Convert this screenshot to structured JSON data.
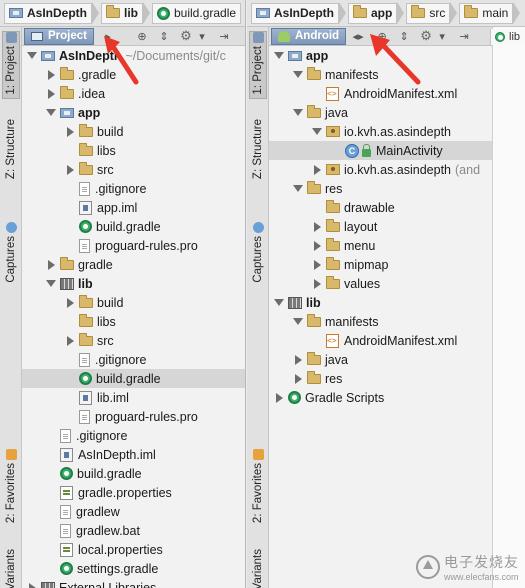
{
  "left": {
    "breadcrumbs": [
      "AsInDepth",
      "lib",
      "build.gradle"
    ],
    "view_label": "Project",
    "side_tabs": [
      "1: Project",
      "Z: Structure",
      "Captures",
      "2: Favorites",
      "Variants"
    ],
    "tree": [
      {
        "depth": 0,
        "arrow": "down",
        "icon": "module",
        "label": "AsInDepth",
        "bold": true,
        "hint": "~/Documents/git/c"
      },
      {
        "depth": 1,
        "arrow": "right",
        "icon": "folder",
        "label": ".gradle"
      },
      {
        "depth": 1,
        "arrow": "right",
        "icon": "folder",
        "label": ".idea"
      },
      {
        "depth": 1,
        "arrow": "down",
        "icon": "module",
        "label": "app",
        "bold": true
      },
      {
        "depth": 2,
        "arrow": "right",
        "icon": "folder",
        "label": "build"
      },
      {
        "depth": 2,
        "arrow": "none",
        "icon": "folder",
        "label": "libs"
      },
      {
        "depth": 2,
        "arrow": "right",
        "icon": "folder",
        "label": "src"
      },
      {
        "depth": 2,
        "arrow": "none",
        "icon": "file",
        "label": ".gitignore"
      },
      {
        "depth": 2,
        "arrow": "none",
        "icon": "iml",
        "label": "app.iml"
      },
      {
        "depth": 2,
        "arrow": "none",
        "icon": "gradle",
        "label": "build.gradle"
      },
      {
        "depth": 2,
        "arrow": "none",
        "icon": "file",
        "label": "proguard-rules.pro"
      },
      {
        "depth": 1,
        "arrow": "right",
        "icon": "folder",
        "label": "gradle"
      },
      {
        "depth": 1,
        "arrow": "down",
        "icon": "lib",
        "label": "lib",
        "bold": true
      },
      {
        "depth": 2,
        "arrow": "right",
        "icon": "folder",
        "label": "build"
      },
      {
        "depth": 2,
        "arrow": "none",
        "icon": "folder",
        "label": "libs"
      },
      {
        "depth": 2,
        "arrow": "right",
        "icon": "folder",
        "label": "src"
      },
      {
        "depth": 2,
        "arrow": "none",
        "icon": "file",
        "label": ".gitignore"
      },
      {
        "depth": 2,
        "arrow": "none",
        "icon": "gradle",
        "label": "build.gradle",
        "selected": true
      },
      {
        "depth": 2,
        "arrow": "none",
        "icon": "iml",
        "label": "lib.iml"
      },
      {
        "depth": 2,
        "arrow": "none",
        "icon": "file",
        "label": "proguard-rules.pro"
      },
      {
        "depth": 1,
        "arrow": "none",
        "icon": "file",
        "label": ".gitignore"
      },
      {
        "depth": 1,
        "arrow": "none",
        "icon": "iml",
        "label": "AsInDepth.iml"
      },
      {
        "depth": 1,
        "arrow": "none",
        "icon": "gradle",
        "label": "build.gradle"
      },
      {
        "depth": 1,
        "arrow": "none",
        "icon": "props",
        "label": "gradle.properties"
      },
      {
        "depth": 1,
        "arrow": "none",
        "icon": "file",
        "label": "gradlew"
      },
      {
        "depth": 1,
        "arrow": "none",
        "icon": "file",
        "label": "gradlew.bat"
      },
      {
        "depth": 1,
        "arrow": "none",
        "icon": "props",
        "label": "local.properties"
      },
      {
        "depth": 1,
        "arrow": "none",
        "icon": "gradle",
        "label": "settings.gradle"
      },
      {
        "depth": 0,
        "arrow": "right",
        "icon": "lib",
        "label": "External Libraries"
      }
    ]
  },
  "right": {
    "breadcrumbs": [
      "AsInDepth",
      "app",
      "src",
      "main"
    ],
    "view_label": "Android",
    "side_tabs": [
      "1: Project",
      "Z: Structure",
      "Captures",
      "2: Favorites",
      "Variants"
    ],
    "tab_peek": "lib",
    "tree": [
      {
        "depth": 0,
        "arrow": "down",
        "icon": "module",
        "label": "app",
        "bold": true
      },
      {
        "depth": 1,
        "arrow": "down",
        "icon": "folder",
        "label": "manifests"
      },
      {
        "depth": 2,
        "arrow": "none",
        "icon": "xml",
        "label": "AndroidManifest.xml"
      },
      {
        "depth": 1,
        "arrow": "down",
        "icon": "folder",
        "label": "java"
      },
      {
        "depth": 2,
        "arrow": "down",
        "icon": "pkg",
        "label": "io.kvh.as.asindepth"
      },
      {
        "depth": 3,
        "arrow": "none",
        "icon": "class",
        "label": "MainActivity",
        "selected": true
      },
      {
        "depth": 2,
        "arrow": "right",
        "icon": "pkg",
        "label": "io.kvh.as.asindepth",
        "hint": "(and"
      },
      {
        "depth": 1,
        "arrow": "down",
        "icon": "folder",
        "label": "res"
      },
      {
        "depth": 2,
        "arrow": "none",
        "icon": "folder",
        "label": "drawable"
      },
      {
        "depth": 2,
        "arrow": "right",
        "icon": "folder",
        "label": "layout"
      },
      {
        "depth": 2,
        "arrow": "right",
        "icon": "folder",
        "label": "menu"
      },
      {
        "depth": 2,
        "arrow": "right",
        "icon": "folder",
        "label": "mipmap"
      },
      {
        "depth": 2,
        "arrow": "right",
        "icon": "folder",
        "label": "values"
      },
      {
        "depth": 0,
        "arrow": "down",
        "icon": "lib",
        "label": "lib",
        "bold": true
      },
      {
        "depth": 1,
        "arrow": "down",
        "icon": "folder",
        "label": "manifests"
      },
      {
        "depth": 2,
        "arrow": "none",
        "icon": "xml",
        "label": "AndroidManifest.xml"
      },
      {
        "depth": 1,
        "arrow": "right",
        "icon": "folder",
        "label": "java"
      },
      {
        "depth": 1,
        "arrow": "right",
        "icon": "folder",
        "label": "res"
      },
      {
        "depth": 0,
        "arrow": "right",
        "icon": "gradle",
        "label": "Gradle Scripts"
      }
    ]
  },
  "watermark": {
    "text": "电子发烧友",
    "sub": "www.elecfans.com"
  },
  "colors": {
    "selection": "#d6d6d6",
    "view_button": "#8ea4c4",
    "annotation_arrow": "#e8362a"
  }
}
